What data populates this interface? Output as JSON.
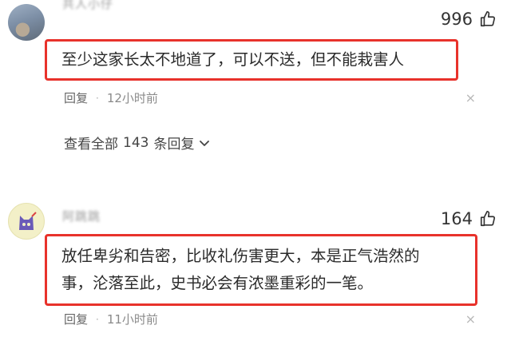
{
  "comments": [
    {
      "username": "共人小仔",
      "likes": "996",
      "text": "至少这家长太不地道了，可以不送，但不能栽害人",
      "reply_label": "回复",
      "dot": "·",
      "time": "12小时前",
      "close": "×",
      "view_all": {
        "prefix": "查看全部",
        "count": "143",
        "suffix": "条回复"
      }
    },
    {
      "username": "阿跳跳",
      "likes": "164",
      "text_line1": "放任卑劣和告密，比收礼伤害更大，本是正气浩然的",
      "text_line2": "事，沦落至此，史书必会有浓墨重彩的一笔。",
      "reply_label": "回复",
      "dot": "·",
      "time": "11小时前",
      "close": "×"
    }
  ],
  "icons": {
    "like": "thumbs-up-icon",
    "chevron": "chevron-down-icon",
    "close": "close-icon"
  },
  "colors": {
    "highlight_border": "#e8322b",
    "meta_text": "#8a8a8a"
  }
}
